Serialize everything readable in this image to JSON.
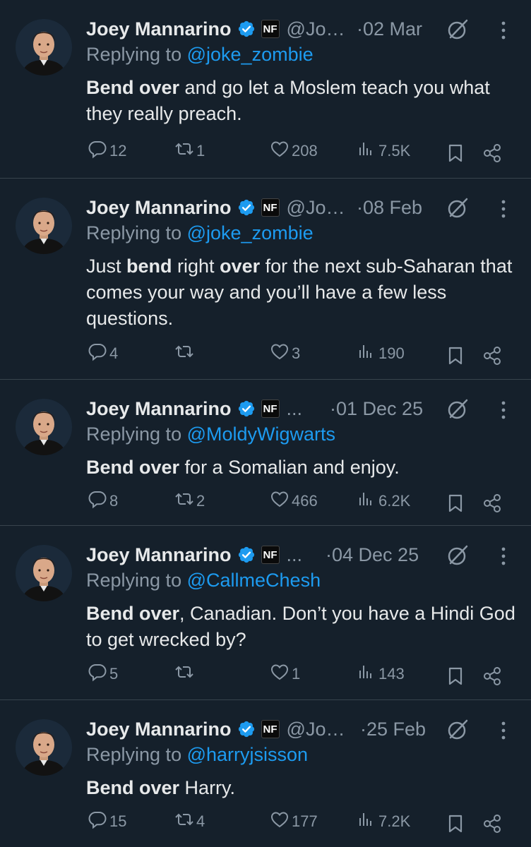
{
  "colors": {
    "background": "#15202b",
    "text": "#e7e9ea",
    "muted": "#8b98a5",
    "link": "#1d9bf0",
    "verified": "#1d9bf0",
    "divider": "#38444d"
  },
  "icons": {
    "verified": "verified-check-icon",
    "affiliate": "nf-affiliate-badge-icon",
    "grok": "grok-icon",
    "more": "more-options-icon",
    "reply": "reply-icon",
    "repost": "repost-icon",
    "like": "like-icon",
    "views": "views-icon",
    "bookmark": "bookmark-icon",
    "share": "share-icon"
  },
  "tweets": [
    {
      "name": "Joey Mannarino",
      "badge": "NF",
      "handle": "@Jo…",
      "dot": "·",
      "date": "02 Mar",
      "replying_prefix": "Replying to",
      "replying_to": "@joke_zombie",
      "body_parts": [
        {
          "text": "Bend over",
          "bold": true
        },
        {
          "text": " and go let a Moslem teach you what they really preach.",
          "bold": false
        }
      ],
      "replies": "12",
      "reposts": "1",
      "likes": "208",
      "views": "7.5K"
    },
    {
      "name": "Joey Mannarino",
      "badge": "NF",
      "handle": "@Jo…",
      "dot": "·",
      "date": "08 Feb",
      "replying_prefix": "Replying to",
      "replying_to": "@joke_zombie",
      "body_parts": [
        {
          "text": "Just ",
          "bold": false
        },
        {
          "text": "bend",
          "bold": true
        },
        {
          "text": " right ",
          "bold": false
        },
        {
          "text": "over",
          "bold": true
        },
        {
          "text": " for the next sub-Saharan that comes your way and you’ll have a few less questions.",
          "bold": false
        }
      ],
      "replies": "4",
      "reposts": "",
      "likes": "3",
      "views": "190"
    },
    {
      "name": "Joey Mannarino",
      "badge": "NF",
      "handle": "...",
      "dot": "·",
      "date": "01 Dec 25",
      "replying_prefix": "Replying to",
      "replying_to": "@MoldyWigwarts",
      "body_parts": [
        {
          "text": "Bend over",
          "bold": true
        },
        {
          "text": " for a Somalian and enjoy.",
          "bold": false
        }
      ],
      "replies": "8",
      "reposts": "2",
      "likes": "466",
      "views": "6.2K"
    },
    {
      "name": "Joey Mannarino",
      "badge": "NF",
      "handle": "...",
      "dot": "·",
      "date": "04 Dec 25",
      "replying_prefix": "Replying to",
      "replying_to": "@CallmeChesh",
      "body_parts": [
        {
          "text": "Bend over",
          "bold": true
        },
        {
          "text": ", Canadian. Don’t you have a Hindi God to get wrecked by?",
          "bold": false
        }
      ],
      "replies": "5",
      "reposts": "",
      "likes": "1",
      "views": "143"
    },
    {
      "name": "Joey Mannarino",
      "badge": "NF",
      "handle": "@Jo…",
      "dot": "·",
      "date": "25 Feb",
      "replying_prefix": "Replying to",
      "replying_to": "@harryjsisson",
      "body_parts": [
        {
          "text": "Bend over",
          "bold": true
        },
        {
          "text": " Harry.",
          "bold": false
        }
      ],
      "replies": "15",
      "reposts": "4",
      "likes": "177",
      "views": "7.2K"
    }
  ]
}
